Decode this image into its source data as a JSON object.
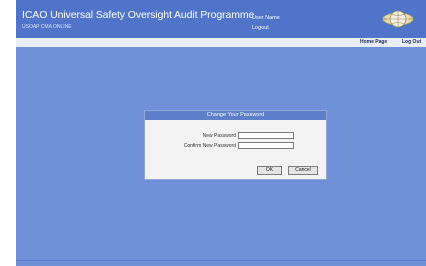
{
  "header": {
    "title": "ICAO Universal Safety Oversight Audit Programme",
    "subtitle": "USOAP CMA ONLINE",
    "user_line1": "User Name",
    "user_line2": "Logout",
    "logo_icon": "icao-globe-logo-icon"
  },
  "nav": {
    "home_label": "Home Page",
    "logout_label": "Log Out"
  },
  "dialog": {
    "title": "Change Your Password",
    "new_password_label": "New Password",
    "confirm_password_label": "Confirm New Password",
    "new_password_value": "",
    "confirm_password_value": "",
    "ok_label": "OK",
    "cancel_label": "Cancel"
  },
  "colors": {
    "background": "#6f8fd6",
    "header": "#4f74c9",
    "navbar": "#e9edf6",
    "dialog_title": "#5d7ec8"
  }
}
